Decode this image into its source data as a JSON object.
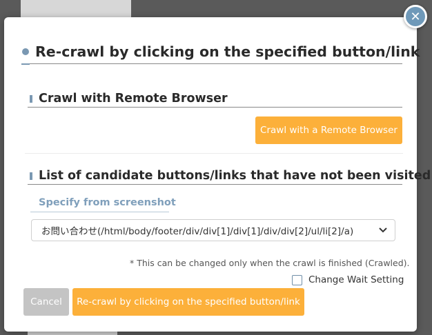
{
  "modal": {
    "title": "Re-crawl by clicking on the specified button/link",
    "close_symbol": "✕"
  },
  "remote_section": {
    "heading": "Crawl with Remote Browser",
    "button_label": "Crawl with a Remote Browser"
  },
  "candidates_section": {
    "heading": "List of candidate buttons/links that have not been visited",
    "screenshot_link_label": "Specify from screenshot",
    "screenshot_icon": "layout-table-icon",
    "selected_option": "お問い合わせ(/html/body/footer/div/div[1]/div[1]/div/div[2]/ul/li[2]/a)"
  },
  "note": "* This can be changed only when the crawl is finished (Crawled).",
  "wait_setting": {
    "label": "Change Wait Setting",
    "checked": false
  },
  "footer": {
    "cancel_label": "Cancel",
    "recrawl_label": "Re-crawl by clicking on the specified button/link"
  },
  "colors": {
    "accent_orange": "#fcb03a",
    "accent_blue": "#7a98b2",
    "cancel_gray": "#c4c4c4",
    "overlay": "#5a5a5a"
  }
}
